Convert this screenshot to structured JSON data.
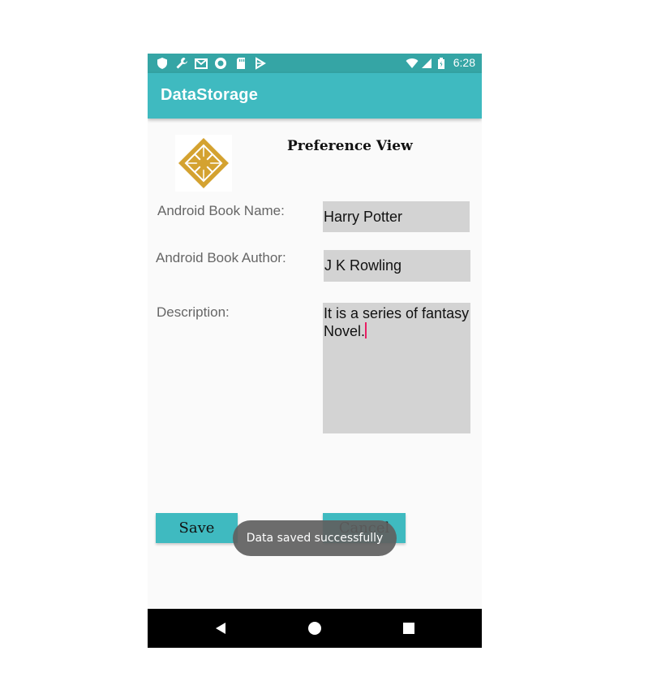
{
  "status_bar": {
    "time": "6:28",
    "left_icons": [
      "shield-icon",
      "wrench-icon",
      "gmail-icon",
      "circle-app-icon",
      "sd-card-icon",
      "play-store-icon"
    ],
    "right_icons": [
      "wifi-icon",
      "cell-signal-icon",
      "battery-icon"
    ]
  },
  "app_bar": {
    "title": "DataStorage",
    "color": "#3fbac0"
  },
  "main": {
    "heading": "Preference View",
    "logo_icon": "diamond-logo-icon",
    "book_name_label": "Android Book Name:",
    "book_name_value": "Harry Potter",
    "book_author_label": "Android Book Author:",
    "book_author_value": "J K Rowling",
    "description_label": "Description:",
    "description_value": "It is a series of fantasy Novel."
  },
  "buttons": {
    "save_label": "Save",
    "cancel_label": "Cancel"
  },
  "toast": {
    "message": "Data saved successfully"
  },
  "nav_bar": {
    "icons": [
      "back-icon",
      "home-icon",
      "recents-icon"
    ]
  },
  "colors": {
    "status_bar": "#35a5a5",
    "accent": "#3fbac0",
    "caret": "#e91e63",
    "field_bg": "#d3d3d3"
  }
}
